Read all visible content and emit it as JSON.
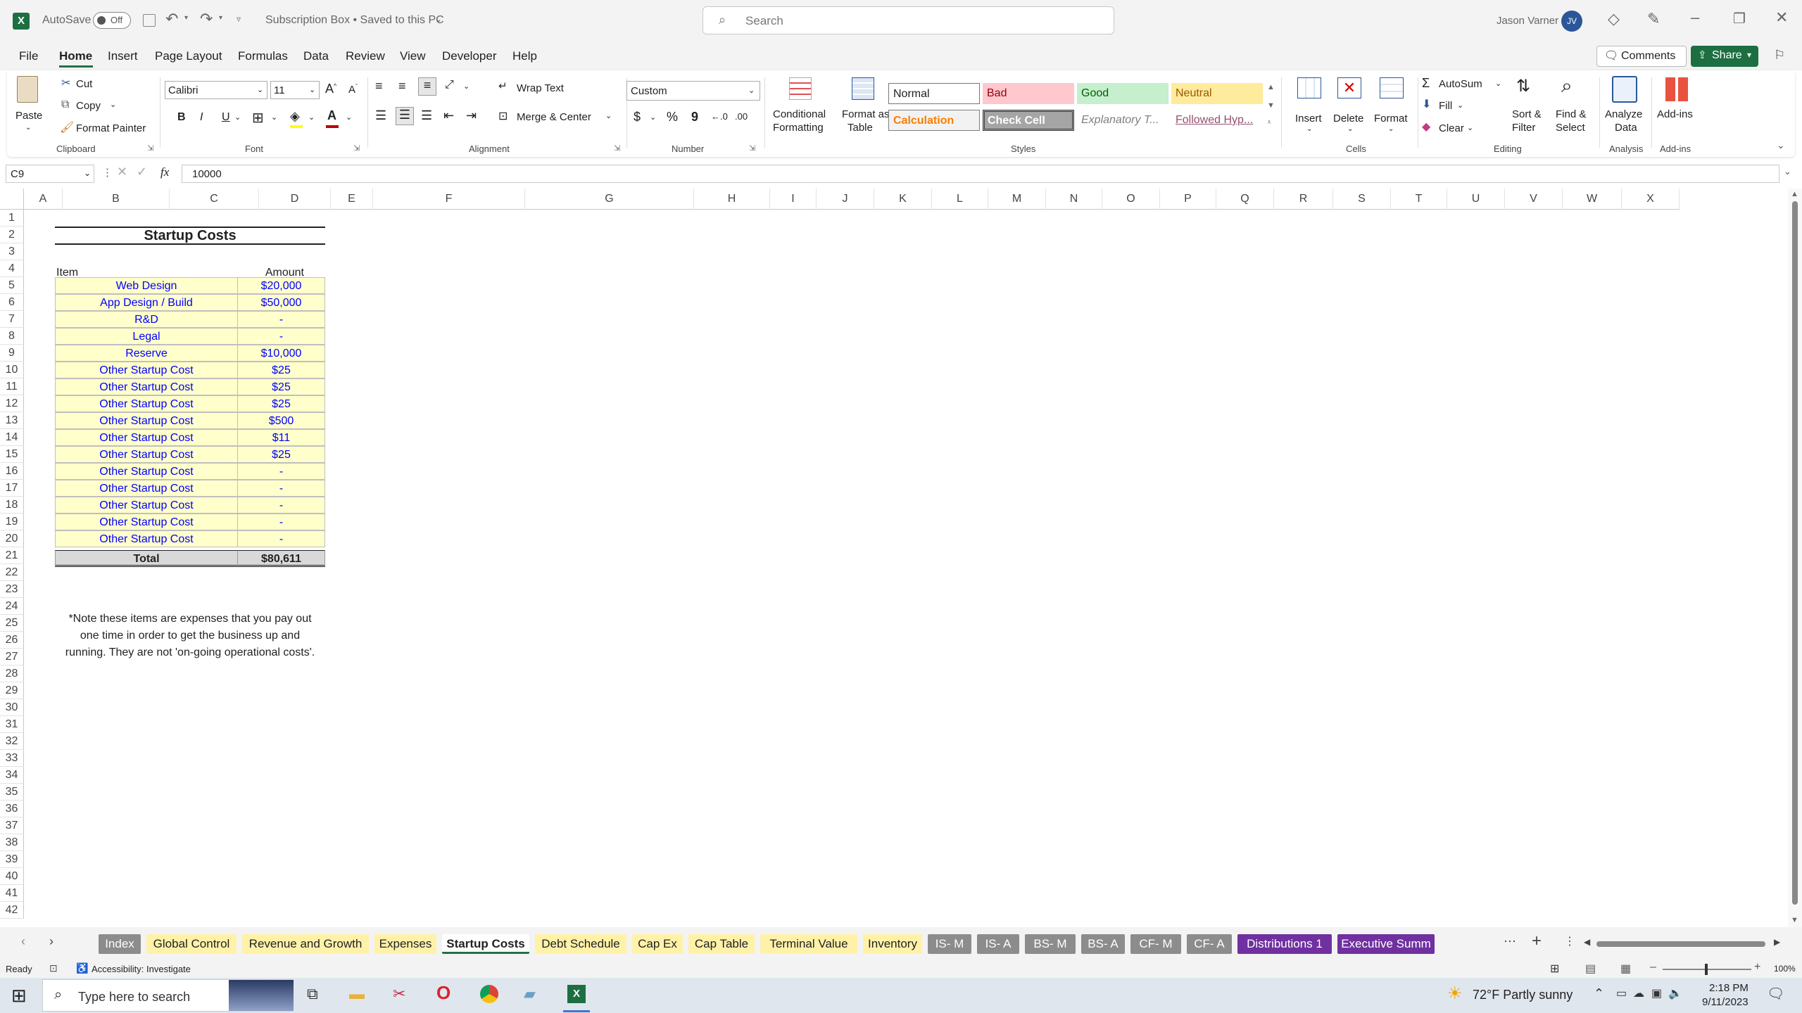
{
  "titlebar": {
    "autosave": "AutoSave",
    "toggle": "Off",
    "doc_title": "Subscription Box • Saved to this PC",
    "search_placeholder": "Search",
    "user_name": "Jason Varner",
    "user_initials": "JV"
  },
  "menu": [
    "File",
    "Home",
    "Insert",
    "Page Layout",
    "Formulas",
    "Data",
    "Review",
    "View",
    "Developer",
    "Help"
  ],
  "menu_right": {
    "comments": "Comments",
    "share": "Share"
  },
  "ribbon": {
    "clipboard": {
      "paste": "Paste",
      "cut": "Cut",
      "copy": "Copy",
      "format_painter": "Format Painter",
      "label": "Clipboard"
    },
    "font": {
      "name": "Calibri",
      "size": "11",
      "label": "Font",
      "bold": "B",
      "italic": "I",
      "underline": "U"
    },
    "alignment": {
      "wrap": "Wrap Text",
      "merge": "Merge & Center",
      "label": "Alignment"
    },
    "number": {
      "format": "Custom",
      "label": "Number",
      "currency": "$",
      "percent": "%",
      "comma": "9"
    },
    "styles": {
      "cf_1": "Conditional",
      "cf_2": "Formatting",
      "fat_1": "Format as",
      "fat_2": "Table",
      "label": "Styles",
      "items": [
        "Normal",
        "Bad",
        "Good",
        "Neutral",
        "Calculation",
        "Check Cell",
        "Explanatory T...",
        "Followed Hyp..."
      ]
    },
    "cells": {
      "insert": "Insert",
      "delete": "Delete",
      "format": "Format",
      "label": "Cells"
    },
    "editing": {
      "autosum": "AutoSum",
      "fill": "Fill",
      "clear": "Clear",
      "sort_1": "Sort &",
      "sort_2": "Filter",
      "find_1": "Find &",
      "find_2": "Select",
      "label": "Editing"
    },
    "analysis": {
      "analyze_1": "Analyze",
      "analyze_2": "Data",
      "label": "Analysis"
    },
    "addins": {
      "addins": "Add-ins",
      "label": "Add-ins"
    }
  },
  "formula": {
    "namebox": "C9",
    "fx": "fx",
    "value": "10000"
  },
  "columns": [
    "A",
    "B",
    "C",
    "D",
    "E",
    "F",
    "G",
    "H",
    "I",
    "J",
    "K",
    "L",
    "M",
    "N",
    "O",
    "P",
    "Q",
    "R",
    "S",
    "T",
    "U",
    "V",
    "W",
    "X"
  ],
  "rows": [
    "1",
    "2",
    "3",
    "4",
    "5",
    "6",
    "7",
    "8",
    "9",
    "10",
    "11",
    "12",
    "13",
    "14",
    "15",
    "16",
    "17",
    "18",
    "19",
    "20",
    "21",
    "22",
    "23",
    "24",
    "25",
    "26",
    "27",
    "28",
    "29",
    "30",
    "31",
    "32",
    "33",
    "34",
    "35",
    "36",
    "37",
    "38",
    "39",
    "40",
    "41",
    "42"
  ],
  "sheet": {
    "title": "Startup Costs",
    "header_item": "Item",
    "header_amount": "Amount",
    "items": [
      {
        "name": "Web Design",
        "amount": "$20,000"
      },
      {
        "name": "App Design / Build",
        "amount": "$50,000"
      },
      {
        "name": "R&D",
        "amount": "-"
      },
      {
        "name": "Legal",
        "amount": "-"
      },
      {
        "name": "Reserve",
        "amount": "$10,000"
      },
      {
        "name": "Other Startup Cost",
        "amount": "$25"
      },
      {
        "name": "Other Startup Cost",
        "amount": "$25"
      },
      {
        "name": "Other Startup Cost",
        "amount": "$25"
      },
      {
        "name": "Other Startup Cost",
        "amount": "$500"
      },
      {
        "name": "Other Startup Cost",
        "amount": "$11"
      },
      {
        "name": "Other Startup Cost",
        "amount": "$25"
      },
      {
        "name": "Other Startup Cost",
        "amount": "-"
      },
      {
        "name": "Other Startup Cost",
        "amount": "-"
      },
      {
        "name": "Other Startup Cost",
        "amount": "-"
      },
      {
        "name": "Other Startup Cost",
        "amount": "-"
      },
      {
        "name": "Other Startup Cost",
        "amount": "-"
      }
    ],
    "total_label": "Total",
    "total_value": "$80,611",
    "note": [
      "*Note these items are expenses that you pay out",
      "one time in order to get the business up and",
      "running. They are not 'on-going operational costs'."
    ]
  },
  "tabs": [
    {
      "label": "Index",
      "color": "#8c8c8c",
      "text": "#fff"
    },
    {
      "label": "Global Control",
      "color": "#fff2a8",
      "text": "#222"
    },
    {
      "label": "Revenue and Growth",
      "color": "#fff2a8",
      "text": "#222"
    },
    {
      "label": "Expenses",
      "color": "#fff2a8",
      "text": "#222"
    },
    {
      "label": "Startup Costs",
      "color": "#ffffff",
      "text": "#222"
    },
    {
      "label": "Debt Schedule",
      "color": "#fff2a8",
      "text": "#222"
    },
    {
      "label": "Cap Ex",
      "color": "#fff2a8",
      "text": "#222"
    },
    {
      "label": "Cap Table",
      "color": "#fff2a8",
      "text": "#222"
    },
    {
      "label": "Terminal Value",
      "color": "#fff2a8",
      "text": "#222"
    },
    {
      "label": "Inventory",
      "color": "#fff2a8",
      "text": "#222"
    },
    {
      "label": "IS- M",
      "color": "#8c8c8c",
      "text": "#fff"
    },
    {
      "label": "IS- A",
      "color": "#8c8c8c",
      "text": "#fff"
    },
    {
      "label": "BS- M",
      "color": "#8c8c8c",
      "text": "#fff"
    },
    {
      "label": "BS- A",
      "color": "#8c8c8c",
      "text": "#fff"
    },
    {
      "label": "CF- M",
      "color": "#8c8c8c",
      "text": "#fff"
    },
    {
      "label": "CF- A",
      "color": "#8c8c8c",
      "text": "#fff"
    },
    {
      "label": "Distributions 1",
      "color": "#7030a0",
      "text": "#fff"
    },
    {
      "label": "Executive Summ",
      "color": "#7030a0",
      "text": "#fff"
    }
  ],
  "status": {
    "ready": "Ready",
    "accessibility": "Accessibility: Investigate",
    "zoom": "100%"
  },
  "taskbar": {
    "search_placeholder": "Type here to search",
    "weather": "72°F  Partly sunny",
    "time": "2:18 PM",
    "date": "9/11/2023"
  },
  "colors": {
    "accent": "#217346",
    "cell_fill": "#ffffcc",
    "cell_text": "#0000ff",
    "total_fill": "#d9d9d9"
  }
}
